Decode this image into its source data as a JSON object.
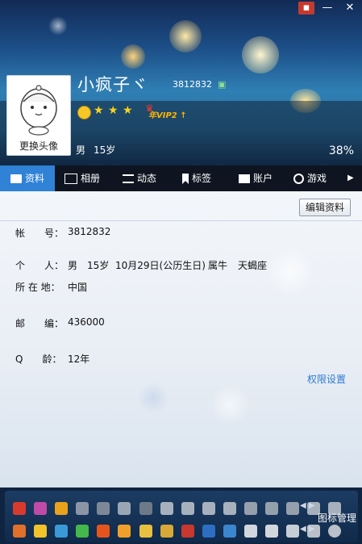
{
  "window": {
    "minimize": "—",
    "close": "✕"
  },
  "profile": {
    "avatar_label": "更换头像",
    "nickname": "小疯子ヾ",
    "qq_number": "3812832",
    "vip_badge": "年VIP2 ↑",
    "gender": "男",
    "age": "15岁",
    "completion": "38%"
  },
  "tabs": [
    {
      "label": "资料",
      "icon": "profile-card-icon"
    },
    {
      "label": "相册",
      "icon": "photo-album-icon"
    },
    {
      "label": "动态",
      "icon": "feed-list-icon"
    },
    {
      "label": "标签",
      "icon": "bookmark-tag-icon"
    },
    {
      "label": "账户",
      "icon": "account-icon"
    },
    {
      "label": "游戏",
      "icon": "game-icon"
    }
  ],
  "info": {
    "edit_button": "编辑资料",
    "account_label": "帐　　号：",
    "account_value": "3812832",
    "personal_label": "个　　人：",
    "personal_gender": "男",
    "personal_age": "15岁",
    "personal_birthday": "10月29日(公历生日)",
    "personal_zodiac": "属牛",
    "personal_star": "天蝎座",
    "location_label": "所 在 地：",
    "location_value": "中国",
    "postcode_label": "邮　　编：",
    "postcode_value": "436000",
    "qage_label": "Q　　龄：",
    "qage_value": "12年",
    "permission_link": "权限设置"
  },
  "icon_bar": {
    "manage_label": "图标管理"
  },
  "colors": {
    "active_tab": "#2f82d6",
    "link": "#2e7ad0",
    "header_top": "#122a55"
  }
}
